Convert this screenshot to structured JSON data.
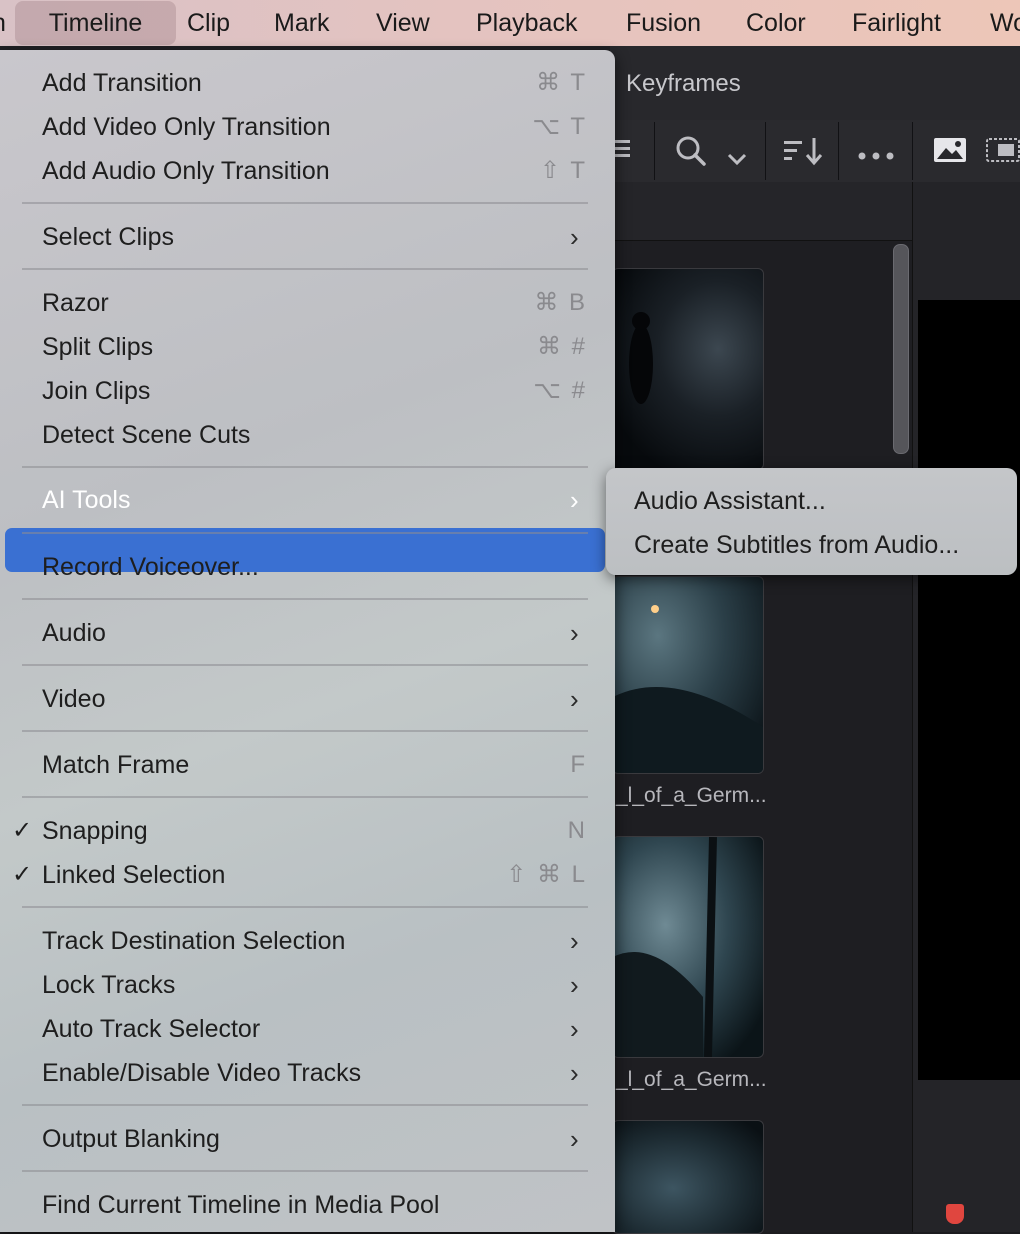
{
  "menubar": {
    "items": [
      "Timeline",
      "Clip",
      "Mark",
      "View",
      "Playback",
      "Fusion",
      "Color",
      "Fairlight",
      "Wo"
    ],
    "active": "Timeline"
  },
  "app": {
    "tab_keyframes": "Keyframes",
    "captions": [
      "_l_of_a_Germ...",
      "_l_of_a_Germ..."
    ]
  },
  "menu": {
    "items": [
      {
        "label": "Add Transition",
        "shortcut": "⌘ T"
      },
      {
        "label": "Add Video Only Transition",
        "shortcut": "⌥ T"
      },
      {
        "label": "Add Audio Only Transition",
        "shortcut": "⇧ T"
      },
      {
        "label": "Select Clips",
        "submenu": true
      },
      {
        "label": "Razor",
        "shortcut": "⌘ B"
      },
      {
        "label": "Split Clips",
        "shortcut": "⌘ #"
      },
      {
        "label": "Join Clips",
        "shortcut": "⌥ #"
      },
      {
        "label": "Detect Scene Cuts"
      },
      {
        "label": "AI Tools",
        "submenu": true,
        "highlighted": true
      },
      {
        "label": "Record Voiceover..."
      },
      {
        "label": "Audio",
        "submenu": true
      },
      {
        "label": "Video",
        "submenu": true
      },
      {
        "label": "Match Frame",
        "shortcut": "F"
      },
      {
        "label": "Snapping",
        "shortcut": "N",
        "checked": true
      },
      {
        "label": "Linked Selection",
        "shortcut": "⇧ ⌘ L",
        "checked": true
      },
      {
        "label": "Track Destination Selection",
        "submenu": true
      },
      {
        "label": "Lock Tracks",
        "submenu": true
      },
      {
        "label": "Auto Track Selector",
        "submenu": true
      },
      {
        "label": "Enable/Disable Video Tracks",
        "submenu": true
      },
      {
        "label": "Output Blanking",
        "submenu": true
      },
      {
        "label": "Find Current Timeline in Media Pool"
      }
    ]
  },
  "submenu": {
    "items": [
      "Audio Assistant...",
      "Create Subtitles from Audio..."
    ]
  },
  "colors": {
    "highlight": "#3a70d2",
    "menubar": "#e4c3c0",
    "menu_bg": "#c3c5c8"
  }
}
